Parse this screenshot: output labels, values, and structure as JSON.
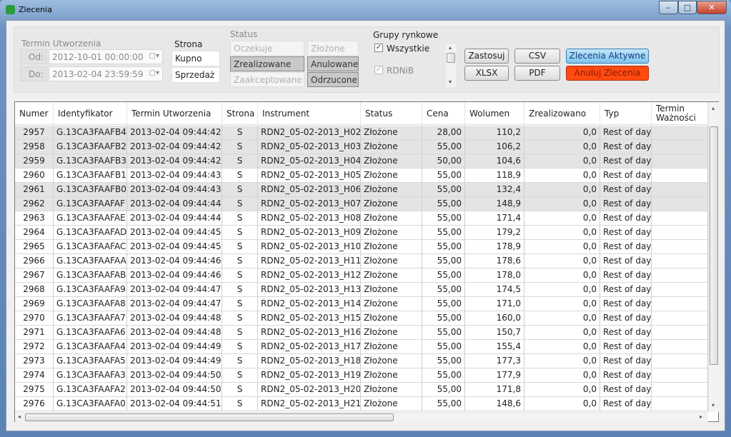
{
  "window": {
    "title": "Zlecenia",
    "minimize": "–",
    "maximize": "□",
    "close": "✕"
  },
  "filters": {
    "termin": {
      "label": "Termin Utworzenia",
      "od_label": "Od:",
      "od_value": "2012-10-01 00:00:00",
      "do_label": "Do:",
      "do_value": "2013-02-04 23:59:59"
    },
    "strona": {
      "label": "Strona",
      "kupno": "Kupno",
      "sprzedaz": "Sprzedaż"
    },
    "status": {
      "label": "Status",
      "oczekuje": "Oczekuje",
      "zlozone": "Złożone",
      "zrealizowane": "Zrealizowane",
      "anulowane": "Anulowane",
      "zaakceptowane": "Zaakceptowane",
      "odrzucone": "Odrzucone"
    },
    "grupy": {
      "label": "Grupy rynkowe",
      "wszystkie": "Wszystkie",
      "wszystkie_checked": true,
      "rdnib": "RDNiB",
      "rdnib_checked": true
    }
  },
  "buttons": {
    "zastosuj": "Zastosuj",
    "csv": "CSV",
    "aktywne": "Zlecenia Aktywne",
    "xlsx": "XLSX",
    "pdf": "PDF",
    "anuluj": "Anuluj Zlecenia"
  },
  "colors": {
    "aktywne": "#8fd0f2",
    "anuluj": "#ff4a10"
  },
  "table": {
    "columns": [
      "Numer",
      "Identyfikator",
      "Termin Utworzenia",
      "Strona",
      "Instrument",
      "Status",
      "Cena",
      "Wolumen",
      "Zrealizowano",
      "Typ",
      "Termin Ważności"
    ],
    "rows": [
      {
        "numer": "2957",
        "id": "G.13CA3FAAFB4",
        "termin": "2013-02-04 09:44:42",
        "strona": "S",
        "instrument": "RDN2_05-02-2013_H02",
        "status": "Złożone",
        "cena": "28,00",
        "wolumen": "110,2",
        "zreal": "0,0",
        "typ": "Rest of day",
        "waznosc": "",
        "selected": true
      },
      {
        "numer": "2958",
        "id": "G.13CA3FAAFB2",
        "termin": "2013-02-04 09:44:42",
        "strona": "S",
        "instrument": "RDN2_05-02-2013_H03",
        "status": "Złożone",
        "cena": "55,00",
        "wolumen": "106,2",
        "zreal": "0,0",
        "typ": "Rest of day",
        "waznosc": "",
        "selected": true
      },
      {
        "numer": "2959",
        "id": "G.13CA3FAAFB3",
        "termin": "2013-02-04 09:44:42",
        "strona": "S",
        "instrument": "RDN2_05-02-2013_H04",
        "status": "Złożone",
        "cena": "50,00",
        "wolumen": "104,6",
        "zreal": "0,0",
        "typ": "Rest of day",
        "waznosc": "",
        "selected": true
      },
      {
        "numer": "2960",
        "id": "G.13CA3FAAFB1",
        "termin": "2013-02-04 09:44:43",
        "strona": "S",
        "instrument": "RDN2_05-02-2013_H05",
        "status": "Złożone",
        "cena": "55,00",
        "wolumen": "118,9",
        "zreal": "0,0",
        "typ": "Rest of day",
        "waznosc": "",
        "selected": false
      },
      {
        "numer": "2961",
        "id": "G.13CA3FAAFB0",
        "termin": "2013-02-04 09:44:43",
        "strona": "S",
        "instrument": "RDN2_05-02-2013_H06",
        "status": "Złożone",
        "cena": "55,00",
        "wolumen": "132,4",
        "zreal": "0,0",
        "typ": "Rest of day",
        "waznosc": "",
        "selected": true
      },
      {
        "numer": "2962",
        "id": "G.13CA3FAAFAF",
        "termin": "2013-02-04 09:44:44",
        "strona": "S",
        "instrument": "RDN2_05-02-2013_H07",
        "status": "Złożone",
        "cena": "55,00",
        "wolumen": "148,9",
        "zreal": "0,0",
        "typ": "Rest of day",
        "waznosc": "",
        "selected": true
      },
      {
        "numer": "2963",
        "id": "G.13CA3FAAFAE",
        "termin": "2013-02-04 09:44:44",
        "strona": "S",
        "instrument": "RDN2_05-02-2013_H08",
        "status": "Złożone",
        "cena": "55,00",
        "wolumen": "171,4",
        "zreal": "0,0",
        "typ": "Rest of day",
        "waznosc": "",
        "selected": false
      },
      {
        "numer": "2964",
        "id": "G.13CA3FAAFAD",
        "termin": "2013-02-04 09:44:45",
        "strona": "S",
        "instrument": "RDN2_05-02-2013_H09",
        "status": "Złożone",
        "cena": "55,00",
        "wolumen": "179,2",
        "zreal": "0,0",
        "typ": "Rest of day",
        "waznosc": "",
        "selected": false
      },
      {
        "numer": "2965",
        "id": "G.13CA3FAAFAC",
        "termin": "2013-02-04 09:44:45",
        "strona": "S",
        "instrument": "RDN2_05-02-2013_H10",
        "status": "Złożone",
        "cena": "55,00",
        "wolumen": "178,9",
        "zreal": "0,0",
        "typ": "Rest of day",
        "waznosc": "",
        "selected": false
      },
      {
        "numer": "2966",
        "id": "G.13CA3FAAFAA",
        "termin": "2013-02-04 09:44:46",
        "strona": "S",
        "instrument": "RDN2_05-02-2013_H11",
        "status": "Złożone",
        "cena": "55,00",
        "wolumen": "178,6",
        "zreal": "0,0",
        "typ": "Rest of day",
        "waznosc": "",
        "selected": false
      },
      {
        "numer": "2967",
        "id": "G.13CA3FAAFAB",
        "termin": "2013-02-04 09:44:46",
        "strona": "S",
        "instrument": "RDN2_05-02-2013_H12",
        "status": "Złożone",
        "cena": "55,00",
        "wolumen": "178,0",
        "zreal": "0,0",
        "typ": "Rest of day",
        "waznosc": "",
        "selected": false
      },
      {
        "numer": "2968",
        "id": "G.13CA3FAAFA9",
        "termin": "2013-02-04 09:44:47",
        "strona": "S",
        "instrument": "RDN2_05-02-2013_H13",
        "status": "Złożone",
        "cena": "55,00",
        "wolumen": "174,5",
        "zreal": "0,0",
        "typ": "Rest of day",
        "waznosc": "",
        "selected": false
      },
      {
        "numer": "2969",
        "id": "G.13CA3FAAFA8",
        "termin": "2013-02-04 09:44:47",
        "strona": "S",
        "instrument": "RDN2_05-02-2013_H14",
        "status": "Złożone",
        "cena": "55,00",
        "wolumen": "171,0",
        "zreal": "0,0",
        "typ": "Rest of day",
        "waznosc": "",
        "selected": false
      },
      {
        "numer": "2970",
        "id": "G.13CA3FAAFA7",
        "termin": "2013-02-04 09:44:48",
        "strona": "S",
        "instrument": "RDN2_05-02-2013_H15",
        "status": "Złożone",
        "cena": "55,00",
        "wolumen": "160,0",
        "zreal": "0,0",
        "typ": "Rest of day",
        "waznosc": "",
        "selected": false
      },
      {
        "numer": "2971",
        "id": "G.13CA3FAAFA6",
        "termin": "2013-02-04 09:44:48",
        "strona": "S",
        "instrument": "RDN2_05-02-2013_H16",
        "status": "Złożone",
        "cena": "55,00",
        "wolumen": "150,7",
        "zreal": "0,0",
        "typ": "Rest of day",
        "waznosc": "",
        "selected": false
      },
      {
        "numer": "2972",
        "id": "G.13CA3FAAFA4",
        "termin": "2013-02-04 09:44:49",
        "strona": "S",
        "instrument": "RDN2_05-02-2013_H17",
        "status": "Złożone",
        "cena": "55,00",
        "wolumen": "155,4",
        "zreal": "0,0",
        "typ": "Rest of day",
        "waznosc": "",
        "selected": false
      },
      {
        "numer": "2973",
        "id": "G.13CA3FAAFA5",
        "termin": "2013-02-04 09:44:49",
        "strona": "S",
        "instrument": "RDN2_05-02-2013_H18",
        "status": "Złożone",
        "cena": "55,00",
        "wolumen": "177,3",
        "zreal": "0,0",
        "typ": "Rest of day",
        "waznosc": "",
        "selected": false
      },
      {
        "numer": "2974",
        "id": "G.13CA3FAAFA3",
        "termin": "2013-02-04 09:44:50",
        "strona": "S",
        "instrument": "RDN2_05-02-2013_H19",
        "status": "Złożone",
        "cena": "55,00",
        "wolumen": "177,9",
        "zreal": "0,0",
        "typ": "Rest of day",
        "waznosc": "",
        "selected": false
      },
      {
        "numer": "2975",
        "id": "G.13CA3FAAFA2",
        "termin": "2013-02-04 09:44:50",
        "strona": "S",
        "instrument": "RDN2_05-02-2013_H20",
        "status": "Złożone",
        "cena": "55,00",
        "wolumen": "171,8",
        "zreal": "0,0",
        "typ": "Rest of day",
        "waznosc": "",
        "selected": false
      },
      {
        "numer": "2976",
        "id": "G.13CA3FAAFA0",
        "termin": "2013-02-04 09:44:51",
        "strona": "S",
        "instrument": "RDN2_05-02-2013_H21",
        "status": "Złożone",
        "cena": "55,00",
        "wolumen": "148,6",
        "zreal": "0,0",
        "typ": "Rest of day",
        "waznosc": "",
        "selected": false
      }
    ]
  }
}
